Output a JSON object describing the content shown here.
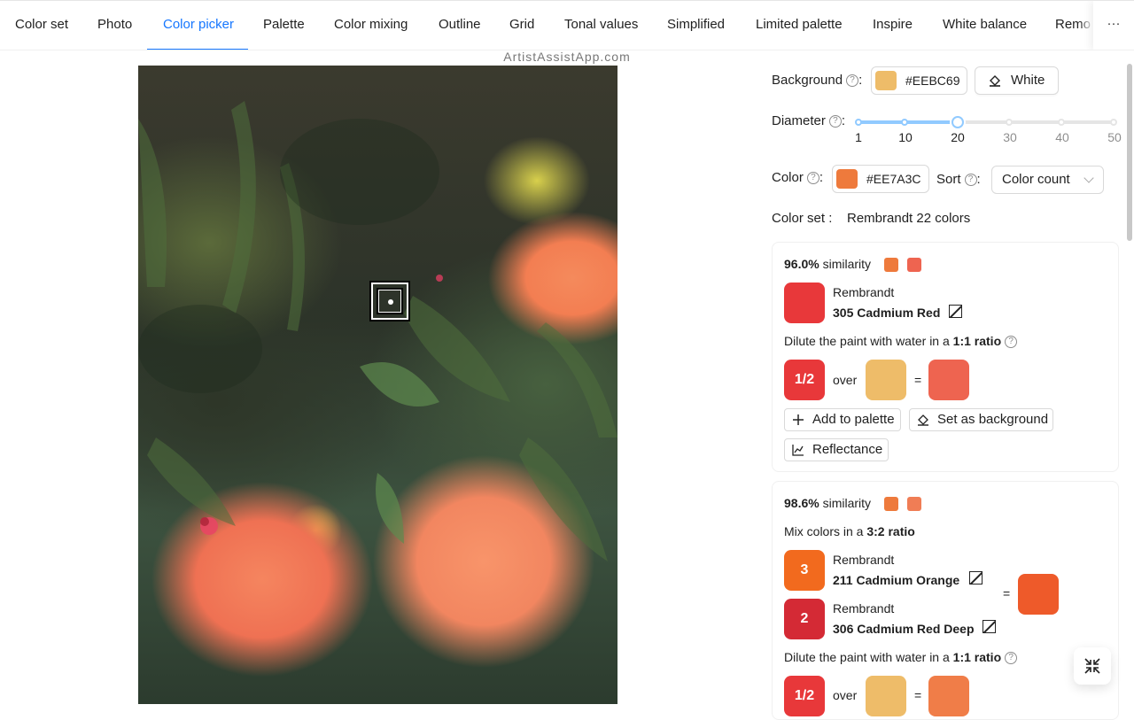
{
  "tabs": [
    {
      "label": "Color set",
      "active": false
    },
    {
      "label": "Photo",
      "active": false
    },
    {
      "label": "Color picker",
      "active": true
    },
    {
      "label": "Palette",
      "active": false
    },
    {
      "label": "Color mixing",
      "active": false
    },
    {
      "label": "Outline",
      "active": false
    },
    {
      "label": "Grid",
      "active": false
    },
    {
      "label": "Tonal values",
      "active": false
    },
    {
      "label": "Simplified",
      "active": false
    },
    {
      "label": "Limited palette",
      "active": false
    },
    {
      "label": "Inspire",
      "active": false
    },
    {
      "label": "White balance",
      "active": false
    },
    {
      "label": "Remo",
      "active": false
    }
  ],
  "more_label": "···",
  "brand": "ArtistAssistApp.com",
  "background": {
    "label": "Background",
    "help": "?",
    "colon": ":",
    "hex": "#EEBC69",
    "white_button": "White"
  },
  "diameter": {
    "label": "Diameter",
    "help": "?",
    "colon": ":",
    "value": 20,
    "marks": [
      "1",
      "10",
      "20",
      "30",
      "40",
      "50"
    ]
  },
  "color": {
    "label": "Color",
    "help": "?",
    "colon": ":",
    "hex": "#EE7A3C"
  },
  "sort": {
    "label": "Sort",
    "help": "?",
    "colon": ":",
    "value": "Color count"
  },
  "color_set": {
    "label": "Color set",
    "colon": ":",
    "value": "Rembrandt 22 colors"
  },
  "card1": {
    "similarity_pct": "96.0%",
    "similarity_word": "similarity",
    "target_color": "#EE7A3C",
    "result_color": "#EE6450",
    "paint_brand": "Rembrandt",
    "paint_name": "305 Cadmium Red",
    "paint_color": "#E8383A",
    "dilute_prefix": "Dilute the paint with water in a",
    "dilute_ratio": "1:1 ratio",
    "fraction": "1/2",
    "over_word": "over",
    "equals": "=",
    "bg_color": "#EEBC69",
    "mix_result": "#EE6450",
    "add_palette": "Add to palette",
    "set_background": "Set as background",
    "reflectance": "Reflectance"
  },
  "card2": {
    "similarity_pct": "98.6%",
    "similarity_word": "similarity",
    "target_color": "#EE7A3C",
    "result_color": "#F07D55",
    "mix_prefix": "Mix colors in a",
    "mix_ratio": "3:2 ratio",
    "paint1_parts": "3",
    "paint1_brand": "Rembrandt",
    "paint1_name": "211 Cadmium Orange",
    "paint1_color": "#F26A1E",
    "paint2_parts": "2",
    "paint2_brand": "Rembrandt",
    "paint2_name": "306 Cadmium Red Deep",
    "paint2_color": "#D42A35",
    "equals": "=",
    "mix_color": "#EE5A2A",
    "dilute_prefix": "Dilute the paint with water in a",
    "dilute_ratio": "1:1 ratio",
    "fraction": "1/2",
    "over_word": "over",
    "bg_color": "#EEBC69",
    "final_color": "#F07D48"
  },
  "colors": {
    "accent": "#1677ff",
    "slider": "#91caff"
  }
}
